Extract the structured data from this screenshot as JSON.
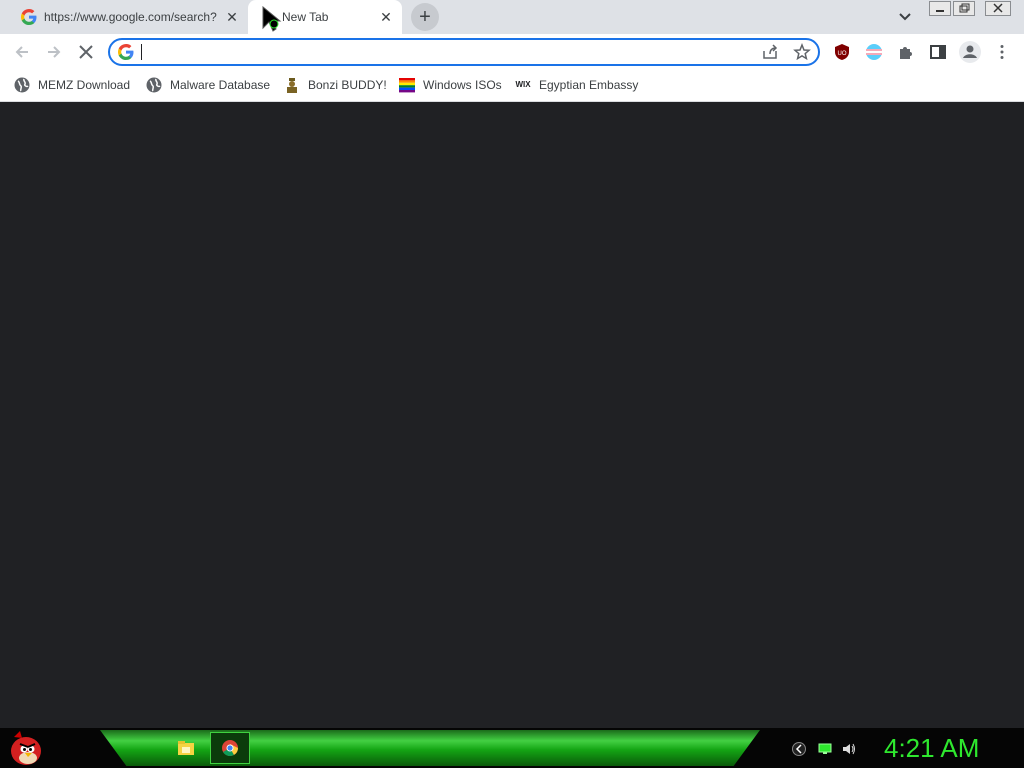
{
  "tabs": [
    {
      "title": "https://www.google.com/search?",
      "close": "✕"
    },
    {
      "title": "New Tab",
      "close": "✕"
    }
  ],
  "new_tab": "+",
  "omnibox": {
    "value": "",
    "placeholder": ""
  },
  "bookmarks": [
    {
      "label": "MEMZ Download",
      "icon": "globe-icon"
    },
    {
      "label": "Malware Database",
      "icon": "globe-icon"
    },
    {
      "label": "Bonzi BUDDY!",
      "icon": "bonzi-icon"
    },
    {
      "label": "Windows ISOs",
      "icon": "rainbow-flag-icon"
    },
    {
      "label": "Egyptian Embassy",
      "icon": "wix-icon"
    }
  ],
  "wix_text": "WIX",
  "ublock_text": "UO",
  "taskbar": {
    "clock": "4:21 AM"
  },
  "colors": {
    "accent": "#1a73e8",
    "clock": "#2ee82e",
    "content_bg": "#202124"
  }
}
